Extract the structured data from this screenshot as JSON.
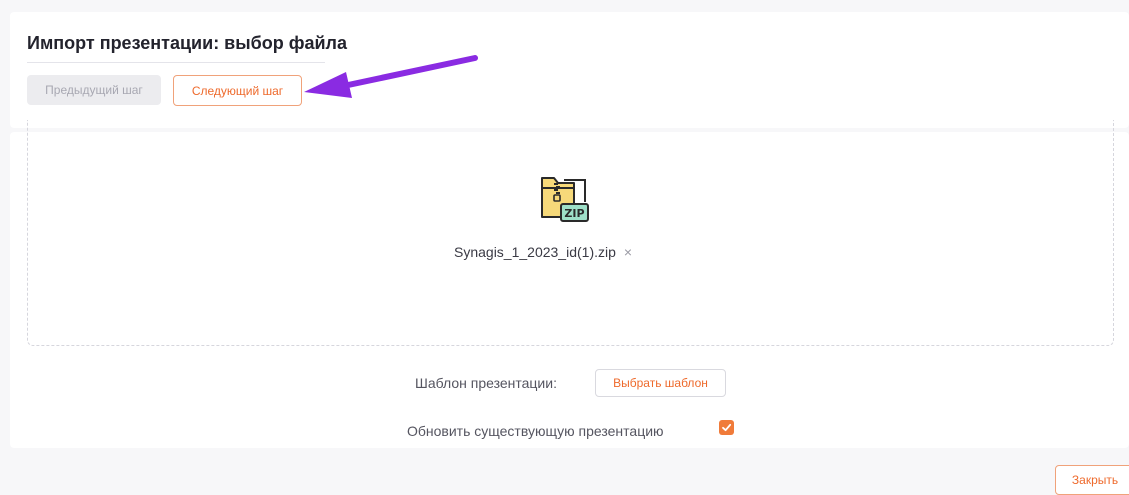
{
  "header": {
    "title": "Импорт презентации: выбор файла",
    "prev_step_label": "Предыдущий шаг",
    "next_step_label": "Следующий шаг"
  },
  "upload": {
    "file_icon": "zip-file-icon",
    "icon_text": "ZIP",
    "file_name": "Synagis_1_2023_id(1).zip",
    "remove_glyph": "×"
  },
  "options": {
    "template_label": "Шаблон презентации:",
    "choose_template_label": "Выбрать шаблон",
    "update_label": "Обновить существующую презентацию",
    "update_checked": true
  },
  "footer": {
    "close_label": "Закрыть"
  },
  "colors": {
    "accent": "#ee6a2c",
    "annotation_arrow": "#8a2be2"
  }
}
